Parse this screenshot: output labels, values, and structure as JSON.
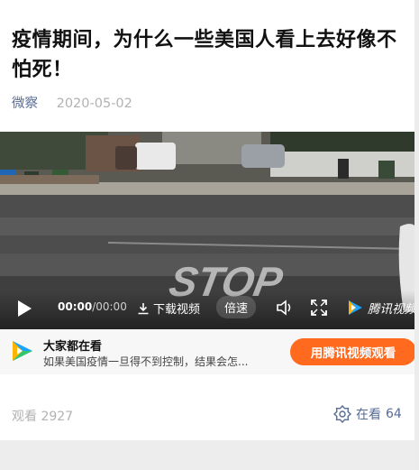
{
  "article": {
    "title": "疫情期间，为什么一些美国人看上去好像不怕死！",
    "source": "微察",
    "date": "2020-05-02"
  },
  "video": {
    "time_current": "00:00",
    "time_total": "/00:00",
    "download_label": "下载视频",
    "speed_label": "倍速",
    "brand_label": "腾讯视频",
    "road_text": "STOP",
    "icons": [
      "play-icon",
      "download-icon",
      "volume-icon",
      "fullscreen-icon",
      "tencent-video-logo"
    ]
  },
  "banner": {
    "title": "大家都在看",
    "description": "如果美国疫情一旦得不到控制，结果会怎...",
    "cta_label": "用腾讯视频观看"
  },
  "stats": {
    "views": "观看 2927",
    "zaikan_label": "在看",
    "zaikan_count": "64"
  },
  "colors": {
    "link": "#576b95",
    "cta": "#ff6a1f",
    "muted": "#b2b2b2"
  }
}
